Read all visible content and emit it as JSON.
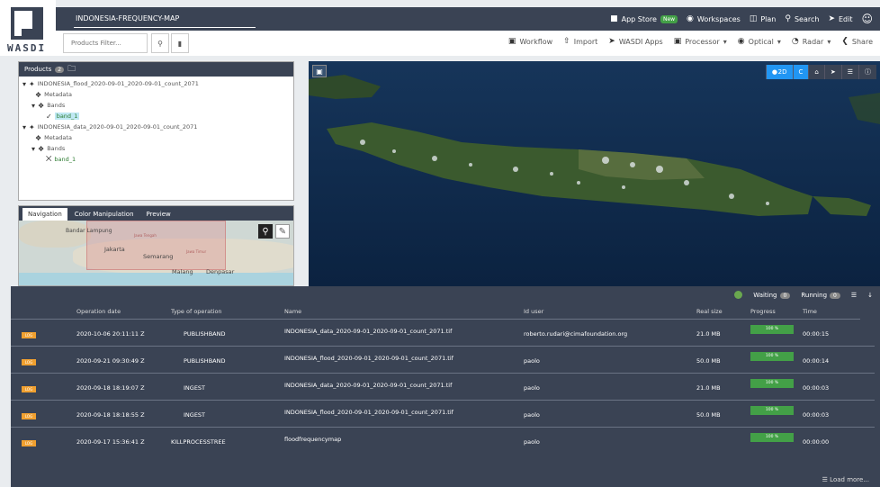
{
  "logo": {
    "text": "WASDI"
  },
  "topbar": {
    "title": "INDONESIA-FREQUENCY-MAP",
    "items": [
      {
        "label": "App Store",
        "badge": "New"
      },
      {
        "label": "Workspaces"
      },
      {
        "label": "Plan"
      },
      {
        "label": "Search"
      },
      {
        "label": "Edit"
      },
      {
        "label": "Share"
      }
    ]
  },
  "toolbar": {
    "filter_placeholder": "Products Filter...",
    "items": [
      "Workflow",
      "Import",
      "WASDI Apps",
      "Processor",
      "Optical",
      "Radar",
      "Share"
    ]
  },
  "products": {
    "header": "Products",
    "count": "2",
    "tree": [
      {
        "label": "INDONESIA_flood_2020-09-01_2020-09-01_count_2071",
        "level": 0
      },
      {
        "label": "Metadata",
        "level": 1
      },
      {
        "label": "Bands",
        "level": 1
      },
      {
        "label": "band_1",
        "level": 2,
        "selected": true
      },
      {
        "label": "INDONESIA_data_2020-09-01_2020-09-01_count_2071",
        "level": 0
      },
      {
        "label": "Metadata",
        "level": 1
      },
      {
        "label": "Bands",
        "level": 1
      },
      {
        "label": "band_1",
        "level": 2,
        "selected": false
      }
    ]
  },
  "navigation": {
    "tabs": [
      "Navigation",
      "Color Manipulation",
      "Preview"
    ],
    "labels": [
      "Bandar Lampung",
      "Jakarta",
      "Semarang",
      "Malang",
      "Denpasar",
      "Jawa Tengah",
      "Jawa Timur"
    ]
  },
  "map": {
    "controls": [
      "2D",
      "C"
    ]
  },
  "process": {
    "waiting_label": "Waiting",
    "waiting_count": "0",
    "running_label": "Running",
    "running_count": "0",
    "columns": [
      "Operation date",
      "Type of operation",
      "Name",
      "Id user",
      "Real size",
      "Progress",
      "Time"
    ],
    "rows": [
      {
        "log": "LOG",
        "date": "2020-10-06 20:11:11 Z",
        "type": "PUBLISHBAND",
        "name": "INDONESIA_data_2020-09-01_2020-09-01_count_2071.tif",
        "user": "roberto.rudari@cimafoundation.org",
        "size": "21.0 MB",
        "progress": "100 %",
        "time": "00:00:15"
      },
      {
        "log": "LOG",
        "date": "2020-09-21 09:30:49 Z",
        "type": "PUBLISHBAND",
        "name": "INDONESIA_flood_2020-09-01_2020-09-01_count_2071.tif",
        "user": "paolo",
        "size": "50.0 MB",
        "progress": "100 %",
        "time": "00:00:14"
      },
      {
        "log": "LOG",
        "date": "2020-09-18 18:19:07 Z",
        "type": "INGEST",
        "name": "INDONESIA_data_2020-09-01_2020-09-01_count_2071.tif",
        "user": "paolo",
        "size": "21.0 MB",
        "progress": "100 %",
        "time": "00:00:03"
      },
      {
        "log": "LOG",
        "date": "2020-09-18 18:18:55 Z",
        "type": "INGEST",
        "name": "INDONESIA_flood_2020-09-01_2020-09-01_count_2071.tif",
        "user": "paolo",
        "size": "50.0 MB",
        "progress": "100 %",
        "time": "00:00:03"
      },
      {
        "log": "LOG",
        "date": "2020-09-17 15:36:41 Z",
        "type": "KILLPROCESSTREE",
        "name": "floodfrequencymap",
        "user": "paolo",
        "size": "",
        "progress": "100 %",
        "time": "00:00:00"
      }
    ],
    "load_more": "Load more..."
  },
  "colors": {
    "header": "#3a4354",
    "accent": "#2196f3",
    "success": "#43a047",
    "log": "#f0a030"
  }
}
